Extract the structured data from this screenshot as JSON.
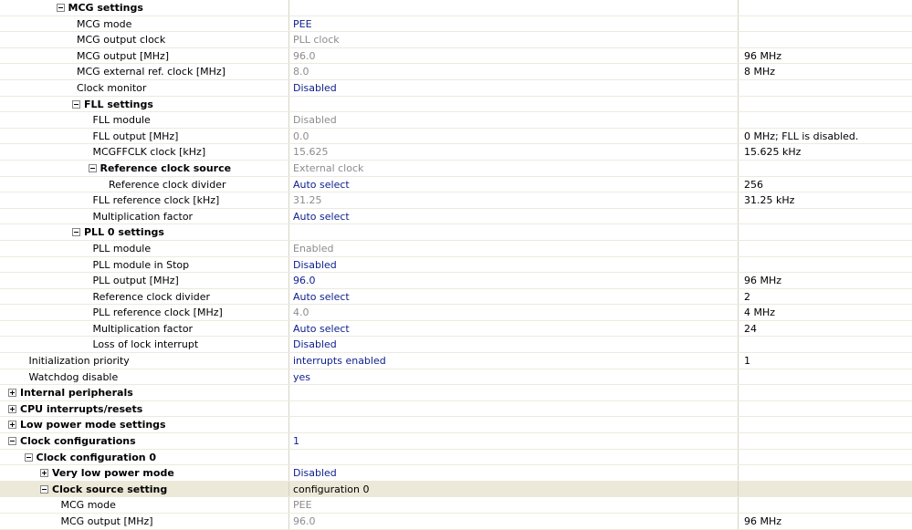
{
  "properties": {
    "rows": [
      {
        "name": "MCG settings",
        "group": true,
        "expanded": true,
        "depth": 3,
        "value": "",
        "value_style": "plain",
        "details": ""
      },
      {
        "name": "MCG mode",
        "group": false,
        "depth": 4,
        "value": "PEE",
        "value_style": "editable",
        "details": ""
      },
      {
        "name": "MCG output clock",
        "group": false,
        "depth": 4,
        "value": "PLL clock",
        "value_style": "readonly",
        "details": ""
      },
      {
        "name": "MCG output [MHz]",
        "group": false,
        "depth": 4,
        "value": "96.0",
        "value_style": "readonly",
        "details": "96 MHz"
      },
      {
        "name": "MCG external ref. clock [MHz]",
        "group": false,
        "depth": 4,
        "value": "8.0",
        "value_style": "readonly",
        "details": "8 MHz"
      },
      {
        "name": "Clock monitor",
        "group": false,
        "depth": 4,
        "value": "Disabled",
        "value_style": "editable",
        "details": ""
      },
      {
        "name": "FLL settings",
        "group": true,
        "expanded": true,
        "depth": 4,
        "value": "",
        "value_style": "plain",
        "details": ""
      },
      {
        "name": "FLL module",
        "group": false,
        "depth": 5,
        "value": "Disabled",
        "value_style": "readonly",
        "details": ""
      },
      {
        "name": "FLL output [MHz]",
        "group": false,
        "depth": 5,
        "value": "0.0",
        "value_style": "readonly",
        "details": "0 MHz; FLL is disabled."
      },
      {
        "name": "MCGFFCLK clock [kHz]",
        "group": false,
        "depth": 5,
        "value": "15.625",
        "value_style": "readonly",
        "details": "15.625 kHz"
      },
      {
        "name": "Reference clock source",
        "group": true,
        "expanded": true,
        "depth": 5,
        "value": "External clock",
        "value_style": "readonly",
        "details": ""
      },
      {
        "name": "Reference clock divider",
        "group": false,
        "depth": 6,
        "value": "Auto select",
        "value_style": "editable",
        "details": "256"
      },
      {
        "name": "FLL reference clock [kHz]",
        "group": false,
        "depth": 5,
        "value": "31.25",
        "value_style": "readonly",
        "details": "31.25 kHz"
      },
      {
        "name": "Multiplication factor",
        "group": false,
        "depth": 5,
        "value": "Auto select",
        "value_style": "editable",
        "details": ""
      },
      {
        "name": "PLL 0 settings",
        "group": true,
        "expanded": true,
        "depth": 4,
        "value": "",
        "value_style": "plain",
        "details": ""
      },
      {
        "name": "PLL module",
        "group": false,
        "depth": 5,
        "value": "Enabled",
        "value_style": "readonly",
        "details": ""
      },
      {
        "name": "PLL module in Stop",
        "group": false,
        "depth": 5,
        "value": "Disabled",
        "value_style": "editable",
        "details": ""
      },
      {
        "name": "PLL output [MHz]",
        "group": false,
        "depth": 5,
        "value": "96.0",
        "value_style": "editable",
        "details": "96 MHz"
      },
      {
        "name": "Reference clock divider",
        "group": false,
        "depth": 5,
        "value": "Auto select",
        "value_style": "editable",
        "details": "2"
      },
      {
        "name": "PLL reference clock [MHz]",
        "group": false,
        "depth": 5,
        "value": "4.0",
        "value_style": "readonly",
        "details": "4 MHz"
      },
      {
        "name": "Multiplication factor",
        "group": false,
        "depth": 5,
        "value": "Auto select",
        "value_style": "editable",
        "details": "24"
      },
      {
        "name": "Loss of lock interrupt",
        "group": false,
        "depth": 5,
        "value": "Disabled",
        "value_style": "editable",
        "details": ""
      },
      {
        "name": "Initialization priority",
        "group": false,
        "depth": 1,
        "value": "interrupts enabled",
        "value_style": "editable",
        "details": "1"
      },
      {
        "name": "Watchdog disable",
        "group": false,
        "depth": 1,
        "value": "yes",
        "value_style": "editable",
        "details": ""
      },
      {
        "name": "Internal peripherals",
        "group": true,
        "expanded": false,
        "depth": 0,
        "value": "",
        "value_style": "plain",
        "details": ""
      },
      {
        "name": "CPU interrupts/resets",
        "group": true,
        "expanded": false,
        "depth": 0,
        "value": "",
        "value_style": "plain",
        "details": ""
      },
      {
        "name": "Low power mode settings",
        "group": true,
        "expanded": false,
        "depth": 0,
        "value": "",
        "value_style": "plain",
        "details": ""
      },
      {
        "name": "Clock configurations",
        "group": true,
        "expanded": true,
        "depth": 0,
        "value": "1",
        "value_style": "editable",
        "details": ""
      },
      {
        "name": "Clock configuration 0",
        "group": true,
        "expanded": true,
        "depth": 1,
        "value": "",
        "value_style": "plain",
        "details": ""
      },
      {
        "name": "Very low power mode",
        "group": true,
        "expanded": false,
        "depth": 2,
        "value": "Disabled",
        "value_style": "editable",
        "details": ""
      },
      {
        "name": "Clock source setting",
        "group": true,
        "expanded": true,
        "depth": 2,
        "value": "configuration 0",
        "value_style": "plain",
        "details": "",
        "selected": true
      },
      {
        "name": "MCG mode",
        "group": false,
        "depth": 3,
        "value": "PEE",
        "value_style": "readonly",
        "details": ""
      },
      {
        "name": "MCG output [MHz]",
        "group": false,
        "depth": 3,
        "value": "96.0",
        "value_style": "readonly",
        "details": "96 MHz"
      }
    ]
  }
}
